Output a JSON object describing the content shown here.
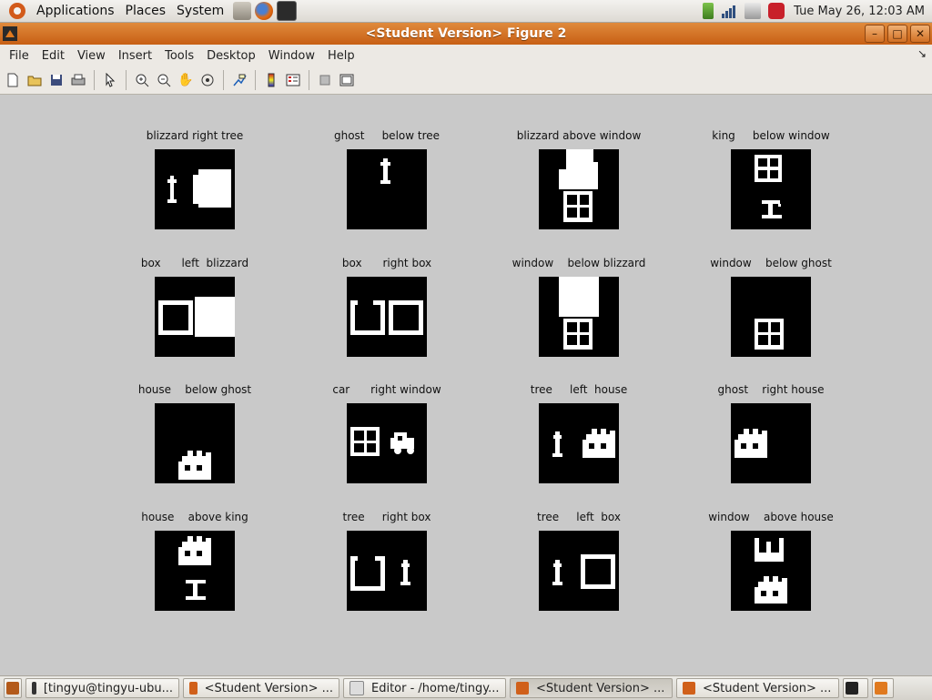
{
  "top_panel": {
    "menus": [
      "Applications",
      "Places",
      "System"
    ],
    "clock": "Tue May 26, 12:03 AM",
    "launchers": [
      "settings-icon",
      "firefox-icon",
      "terminal-icon"
    ],
    "tray_icons": [
      "battery-icon",
      "network-icon",
      "volume-icon",
      "power-icon"
    ]
  },
  "window": {
    "title": "<Student Version> Figure 2",
    "controls": [
      "minimize",
      "maximize",
      "close"
    ],
    "menu": [
      "File",
      "Edit",
      "View",
      "Insert",
      "Tools",
      "Desktop",
      "Window",
      "Help"
    ]
  },
  "toolbar": [
    "new-figure-icon",
    "open-icon",
    "save-icon",
    "print-icon",
    "pointer-icon",
    "zoom-in-icon",
    "zoom-out-icon",
    "pan-icon",
    "rotate-icon",
    "data-cursor-icon",
    "colorbar-icon",
    "legend-icon",
    "hide-plot-tools-icon",
    "show-plot-tools-icon"
  ],
  "panels": [
    {
      "title": "blizzard right tree"
    },
    {
      "title": "ghost     below tree"
    },
    {
      "title": "blizzard above window"
    },
    {
      "title": "king     below window"
    },
    {
      "title": "box      left  blizzard"
    },
    {
      "title": "box      right box"
    },
    {
      "title": "window    below blizzard"
    },
    {
      "title": "window    below ghost"
    },
    {
      "title": "house    below ghost"
    },
    {
      "title": "car      right window"
    },
    {
      "title": "tree     left  house"
    },
    {
      "title": "ghost    right house"
    },
    {
      "title": "house    above king"
    },
    {
      "title": "tree     right box"
    },
    {
      "title": "tree     left  box"
    },
    {
      "title": "window    above house"
    }
  ],
  "taskbar": [
    {
      "label": "[tingyu@tingyu-ubu...",
      "icon": "terminal-icon",
      "active": false
    },
    {
      "label": "<Student Version> ...",
      "icon": "matlab-icon",
      "active": false
    },
    {
      "label": "Editor - /home/tingy...",
      "icon": "editor-icon",
      "active": false
    },
    {
      "label": "<Student Version> ...",
      "icon": "matlab-icon",
      "active": true
    },
    {
      "label": "<Student Version> ...",
      "icon": "matlab-icon",
      "active": false
    }
  ]
}
